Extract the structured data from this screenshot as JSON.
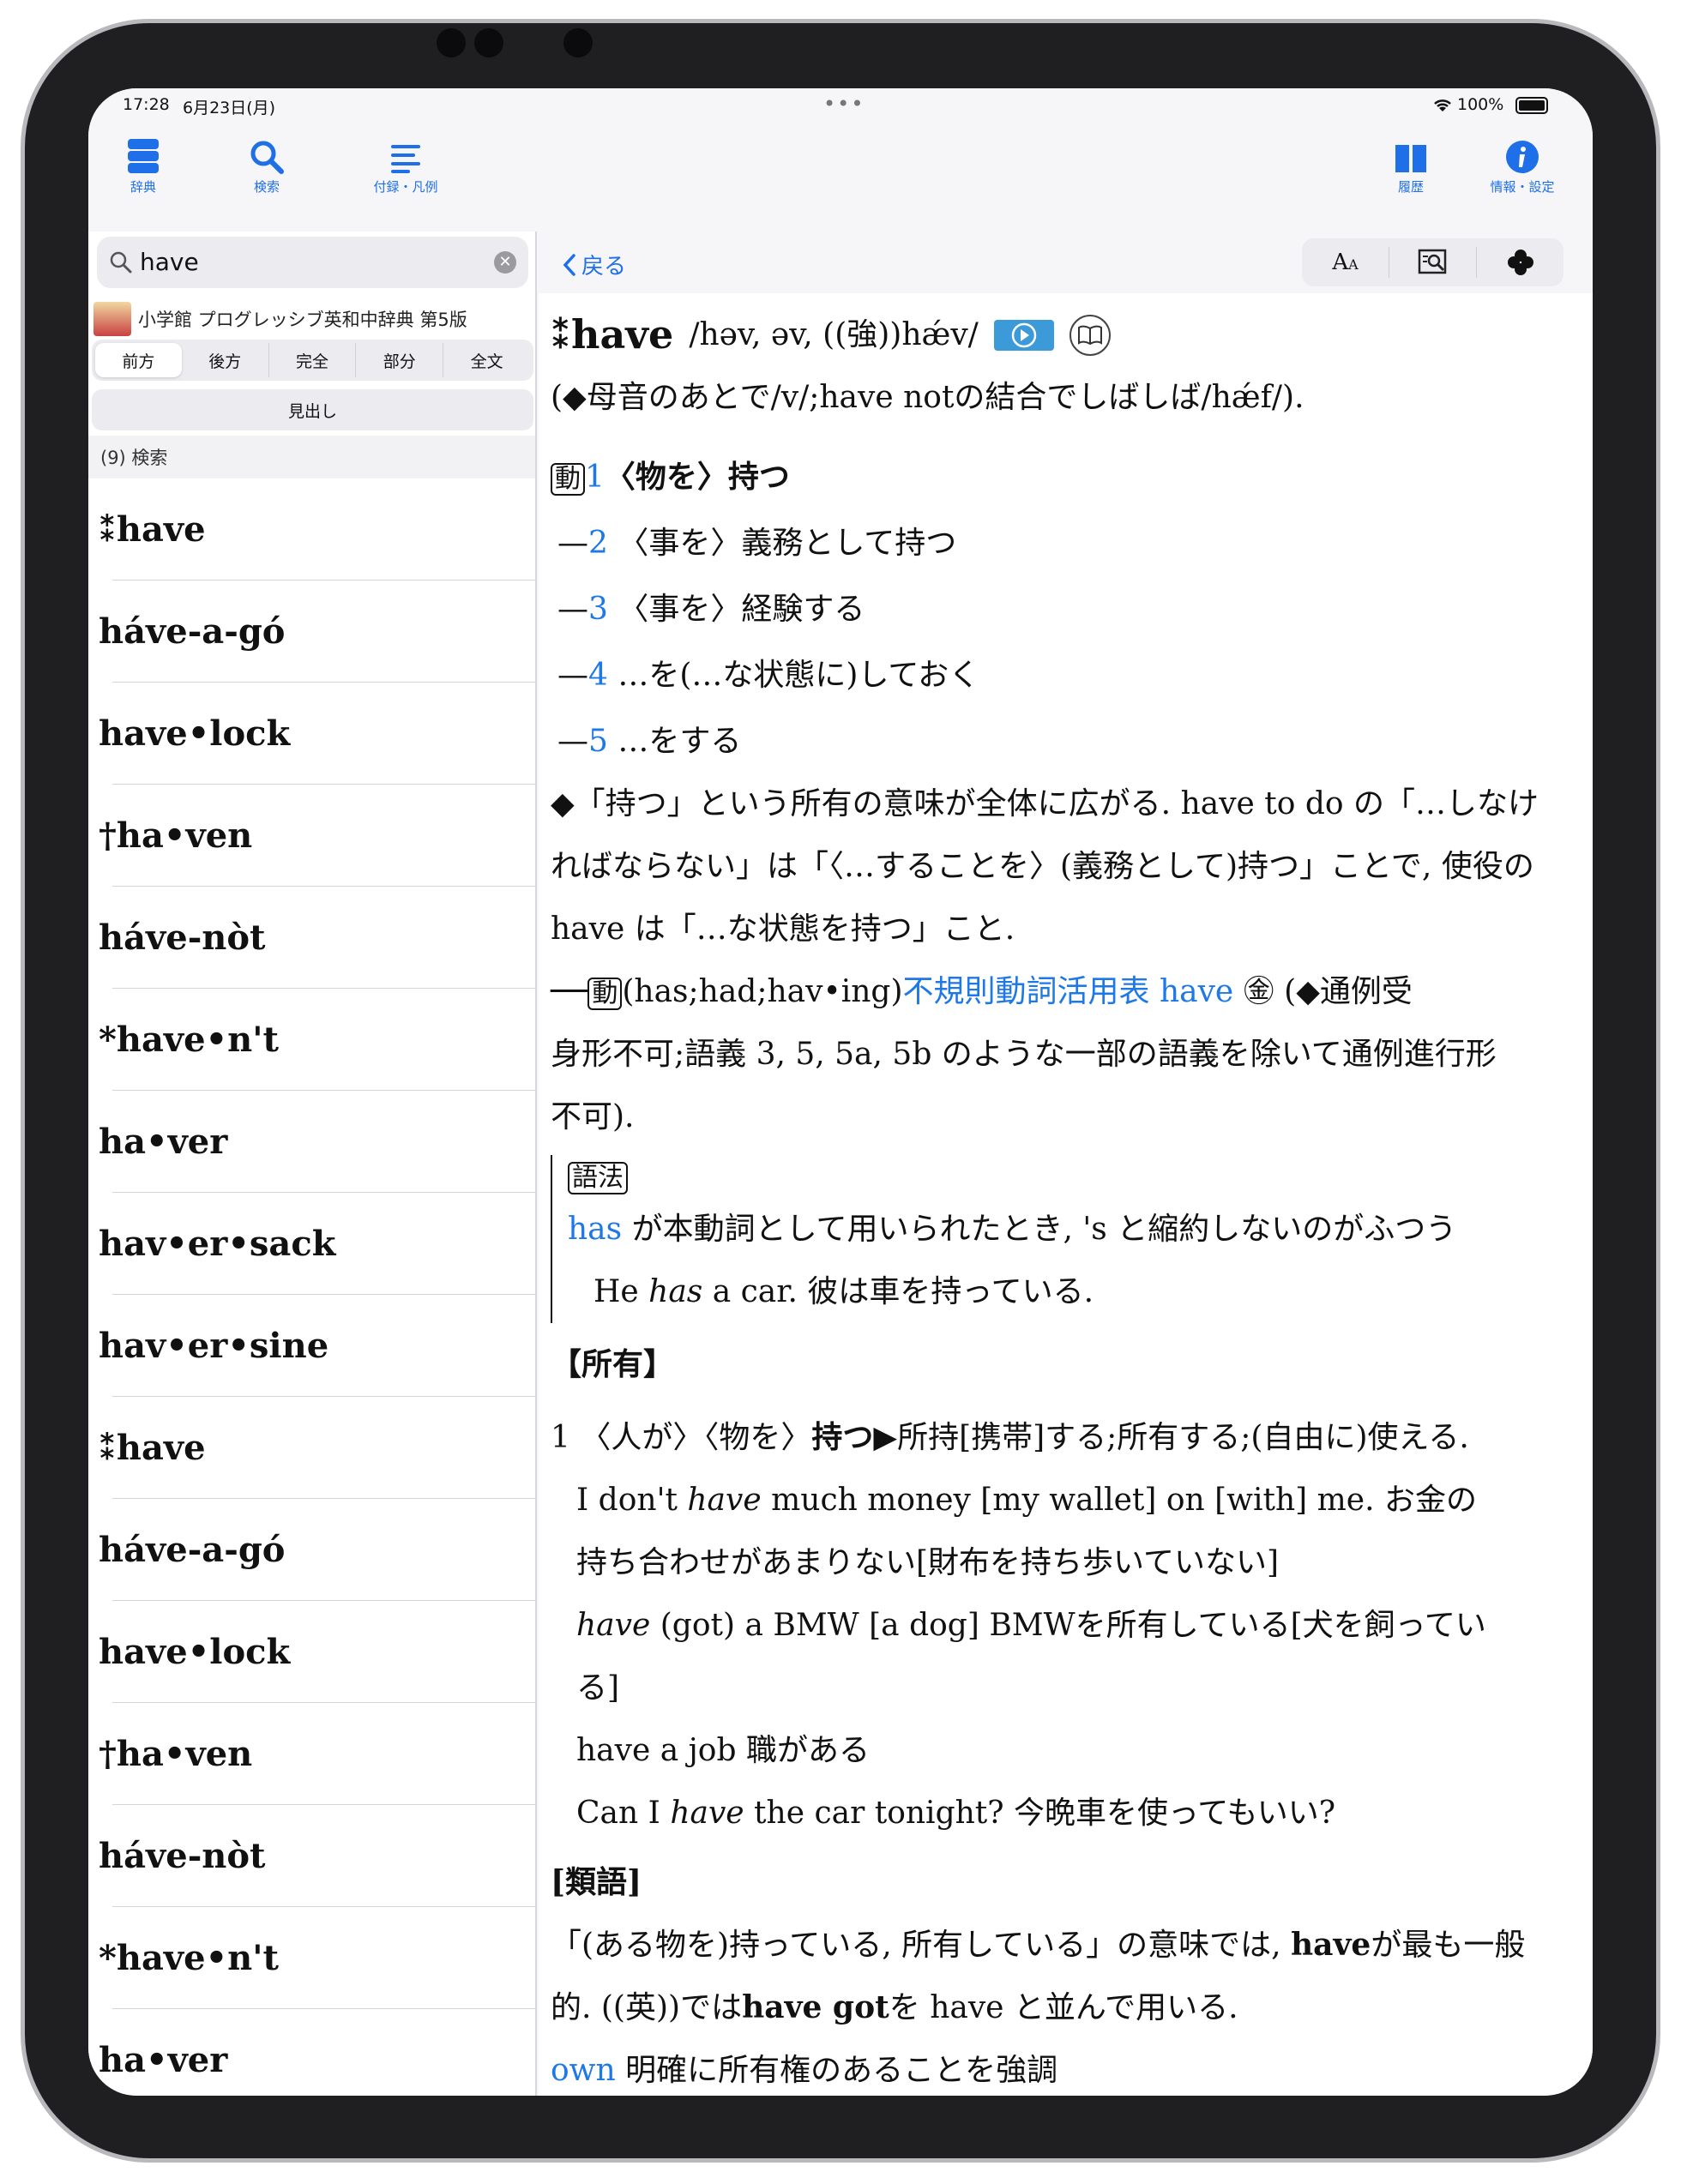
{
  "status": {
    "time": "17:28",
    "date": "6月23日(月)",
    "battery": "100%"
  },
  "toolbar": {
    "dict": "辞典",
    "search": "検索",
    "appendix": "付録・凡例",
    "history": "履歴",
    "info": "情報・設定"
  },
  "search": {
    "value": "have"
  },
  "dict_title": "小学館 プログレッシブ英和中辞典 第5版",
  "segments": [
    "前方",
    "後方",
    "完全",
    "部分",
    "全文"
  ],
  "midashi": "見出し",
  "result_count": "(9) 検索",
  "results": [
    "⁑have",
    "háve-a-gó",
    "have•lock",
    "†ha•ven",
    "háve-nòt",
    "*have•n't",
    "ha•ver",
    "hav•er•sack",
    "hav•er•sine",
    "⁑have",
    "háve-a-gó",
    "have•lock",
    "†ha•ven",
    "háve-nòt",
    "*have•n't",
    "ha•ver"
  ],
  "nav": {
    "back": "戻る",
    "font_size_icon": "AA"
  },
  "entry": {
    "headword": "⁑have",
    "pron": "/həv, əv, ((強))hǽv/",
    "note": "(◆母音のあとで/v/;have notの結合でしばしば/hǽf/).",
    "pos": "動",
    "senses": [
      {
        "num": "1",
        "text": "〈物を〉持つ"
      },
      {
        "num": "2",
        "text": "〈事を〉義務として持つ"
      },
      {
        "num": "3",
        "text": "〈事を〉経験する"
      },
      {
        "num": "4",
        "text": "…を(…な状態に)しておく"
      },
      {
        "num": "5",
        "text": "…をする"
      }
    ],
    "p1": "◆「持つ」という所有の意味が全体に広がる. have to do の「…しなけ",
    "p2": "ればならない」は「〈…することを〉(義務として)持つ」ことで, 使役の",
    "p3": "have は「…な状態を持つ」こと.",
    "forms_a": "──",
    "forms_b": "(has;had;hav•ing)",
    "forms_link": "不規則動詞活用表 have",
    "forms_c": "㊎ (◆通例受",
    "p4": "身形不可;語義 3, 5, 5a, 5b のような一部の語義を除いて通例進行形",
    "p5": "不可).",
    "usage_label": "語法",
    "usage_link": "has",
    "usage_text": " が本動詞として用いられたとき, 's と縮約しないのがふつう",
    "usage_ex_a": "He ",
    "usage_ex_i": "has",
    "usage_ex_b": " a car.  彼は車を持っている.",
    "section": "【所有】",
    "s1_num": "1",
    "s1_a": "〈人が〉〈物を〉",
    "s1_b": "持つ",
    "s1_c": "▶所持[携帯]する;所有する;(自由に)使える.",
    "ex1a": "I don't ",
    "ex1i": "have",
    "ex1b": " much money [my wallet] on [with] me.  お金の",
    "ex1c": "持ち合わせがあまりない[財布を持ち歩いていない]",
    "ex2i": "have",
    "ex2b": " (got) a BMW [a dog]  BMWを所有している[犬を飼ってい",
    "ex2c": "る]",
    "ex3": "have a job  職がある",
    "ex4a": "Can I ",
    "ex4i": "have",
    "ex4b": " the car tonight?  今晩車を使ってもいい?",
    "syn_label": "[類語]",
    "syn1a": "「(ある物を)持っている, 所有している」の意味では, ",
    "syn1b": "have",
    "syn1c": "が最も一般",
    "syn2a": "的. ((英))では",
    "syn2b": "have got",
    "syn2c": "を have と並んで用いる.",
    "syn3a": "own",
    "syn3b": " 明確に所有権のあることを強調"
  }
}
